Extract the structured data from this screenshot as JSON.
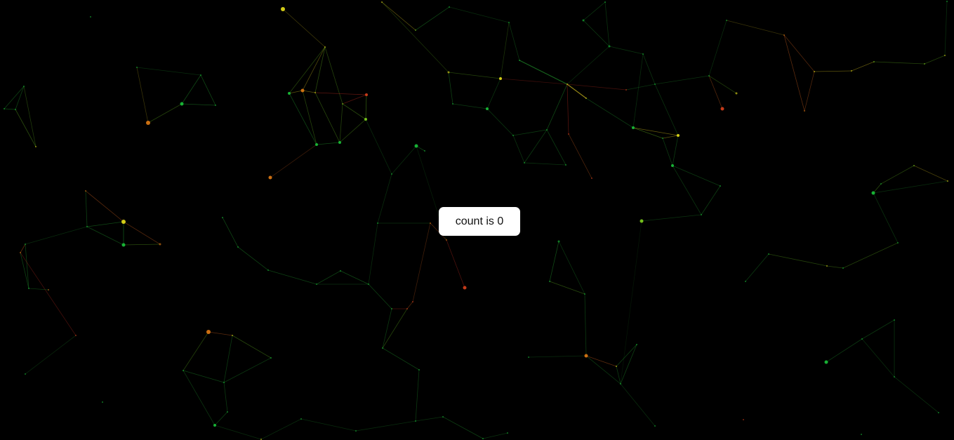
{
  "colors": {
    "background": "#000000",
    "button_bg": "#ffffff",
    "button_text": "#111111",
    "node_palette": [
      "#19c23a",
      "#7fd11f",
      "#e8e01a",
      "#e07a14",
      "#d8401c"
    ],
    "edge_palette": [
      "#1f8f2a",
      "#5aa51c",
      "#b8a61a",
      "#b5541a",
      "#a8261c"
    ]
  },
  "counter": {
    "label": "count is 0",
    "count": 0
  }
}
